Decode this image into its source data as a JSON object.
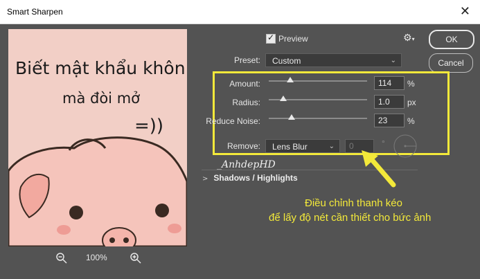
{
  "window": {
    "title": "Smart Sharpen",
    "close_icon": "close-icon"
  },
  "preview": {
    "text_line1": "Biết mật khẩu khôn",
    "text_line2": "mà đòi mở",
    "emoticon": "=))",
    "zoom": "100%"
  },
  "options": {
    "preview_label": "Preview",
    "preview_checked": true
  },
  "buttons": {
    "ok": "OK",
    "cancel": "Cancel"
  },
  "preset": {
    "label": "Preset:",
    "value": "Custom"
  },
  "sliders": {
    "amount": {
      "label": "Amount:",
      "value": "114",
      "unit": "%",
      "level": 0.22
    },
    "radius": {
      "label": "Radius:",
      "value": "1.0",
      "unit": "px",
      "level": 0.15
    },
    "reduce_noise": {
      "label": "Reduce Noise:",
      "value": "23",
      "unit": "%",
      "level": 0.23
    }
  },
  "remove": {
    "label": "Remove:",
    "value": "Lens Blur",
    "angle_value": "0",
    "degree_symbol": "°"
  },
  "sections": {
    "shadows_highlights": "Shadows / Highlights"
  },
  "watermark": "_AnhdepHD",
  "annotation": {
    "line1": "Điều chỉnh thanh kéo",
    "line2": "để lấy độ nét cần thiết cho bức ảnh",
    "color": "#f3e93a"
  }
}
